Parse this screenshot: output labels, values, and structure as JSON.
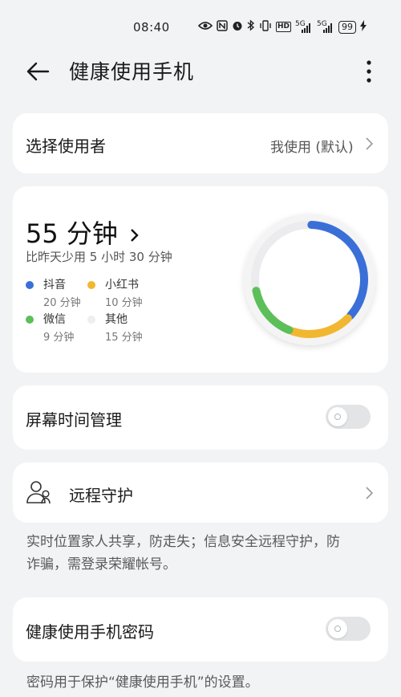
{
  "status_bar": {
    "time": "08:40",
    "icons": [
      "eye-icon",
      "nfc-icon",
      "alarm-icon",
      "bluetooth-icon",
      "vibrate-icon",
      "hd-icon",
      "signal-5g-icon",
      "signal-5g-icon",
      "battery-icon",
      "charging-icon"
    ],
    "hd_label": "HD",
    "network_label_1": "5G",
    "network_label_2": "5G",
    "battery": "99"
  },
  "header": {
    "title": "健康使用手机"
  },
  "choose_user": {
    "label": "选择使用者",
    "value": "我使用 (默认)"
  },
  "usage": {
    "total": "55 分钟",
    "compare": "比昨天少用 5 小时 30 分钟",
    "apps": [
      {
        "name": "抖音",
        "time": "20 分钟",
        "color": "#3a6fd8",
        "minutes": 20
      },
      {
        "name": "小红书",
        "time": "10 分钟",
        "color": "#f2b731",
        "minutes": 10
      },
      {
        "name": "微信",
        "time": "9 分钟",
        "color": "#5cbf5a",
        "minutes": 9
      },
      {
        "name": "其他",
        "time": "15 分钟",
        "color": "#eeeeee",
        "minutes": 15
      }
    ]
  },
  "screen_time": {
    "label": "屏幕时间管理",
    "enabled": false
  },
  "remote_guard": {
    "label": "远程守护",
    "description_line1": "实时位置家人共享，防走失；信息安全远程守护，防",
    "description_line2": "诈骗，需登录荣耀帐号。"
  },
  "password": {
    "label": "健康使用手机密码",
    "enabled": false,
    "description": "密码用于保护“健康使用手机”的设置。"
  }
}
